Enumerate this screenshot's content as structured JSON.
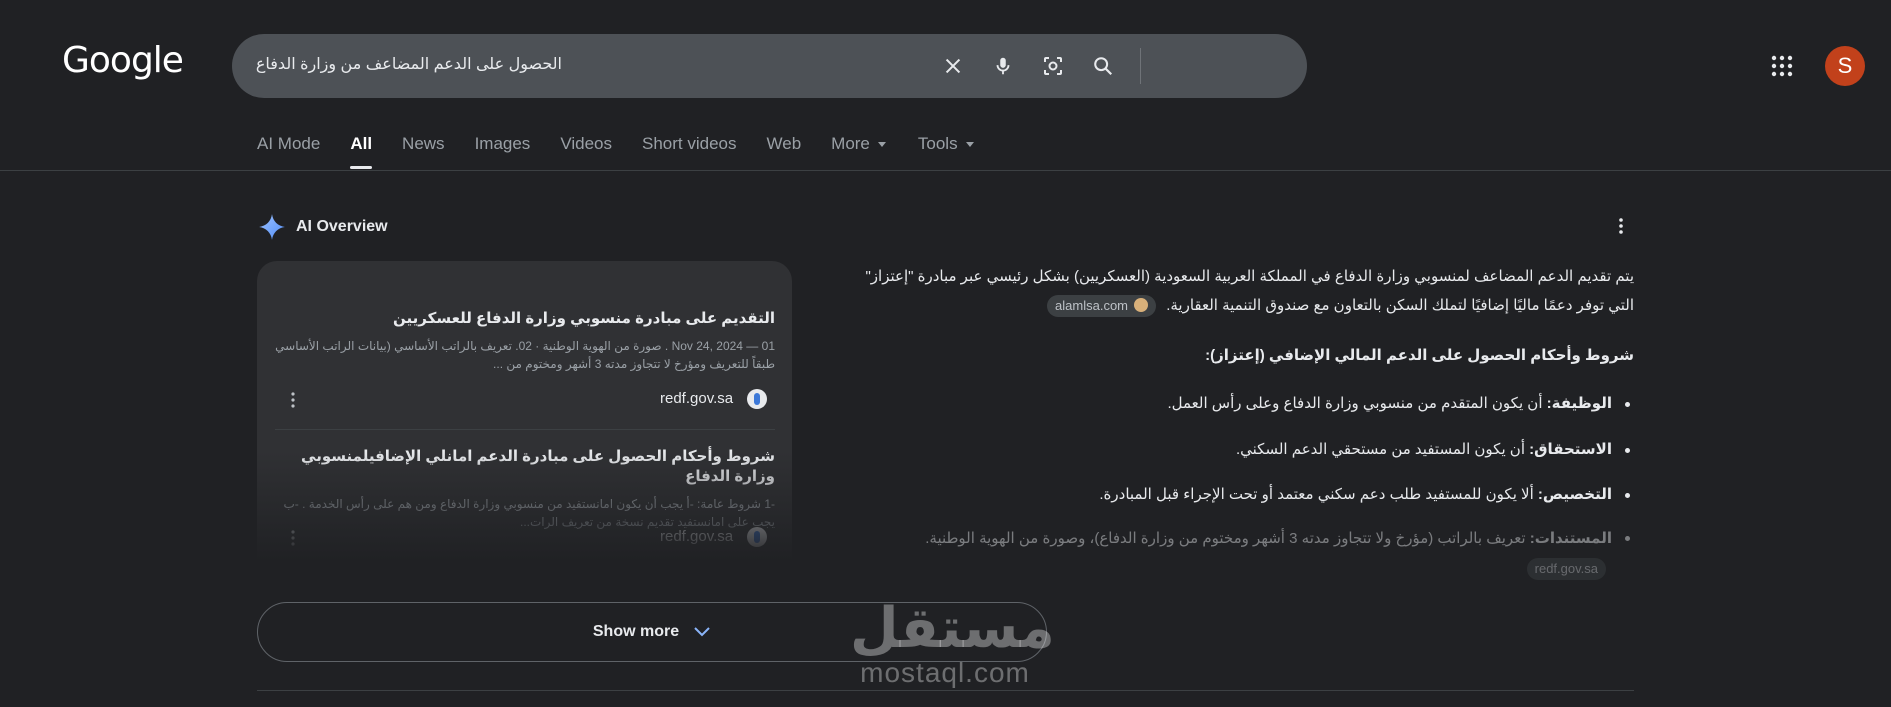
{
  "header": {
    "logo": "Google",
    "search": {
      "query": "الحصول على الدعم المضاعف من وزارة الدفاع"
    },
    "avatar_letter": "S"
  },
  "tabs": [
    {
      "label": "AI Mode"
    },
    {
      "label": "All"
    },
    {
      "label": "News"
    },
    {
      "label": "Images"
    },
    {
      "label": "Videos"
    },
    {
      "label": "Short videos"
    },
    {
      "label": "Web"
    },
    {
      "label": "More"
    },
    {
      "label": "Tools"
    }
  ],
  "ai_overview": {
    "title": "AI Overview",
    "sources": [
      {
        "title": "التقديم على مبادرة منسوبي وزارة الدفاع للعسكريين",
        "snippet": "01 — Nov 24, 2024 . صورة من الهوية الوطنية · 02. تعريف بالراتب الأساسي (بيانات الراتب الأساسي طبقاً للتعريف ومؤرخ لا تتجاوز مدته 3 أشهر ومختوم من ...",
        "site": "redf.gov.sa"
      },
      {
        "title": "شروط وأحكام الحصول على مبادرة الدعم امانلي الإضافيلمنسوبي وزارة الدفاع",
        "snippet": "-1 شروط عامة: -أ يجب أن يكون امانستفيد من منسوبي وزارة الدفاع ومن هم على رأس الخدمة . -ب يجب على امانستفيد تقديم نسخة من تعريف الرات...",
        "site": "redf.gov.sa"
      }
    ],
    "intro": "يتم تقديم الدعم المضاعف لمنسوبي وزارة الدفاع في المملكة العربية السعودية (العسكريين) بشكل رئيسي عبر مبادرة \"إعتزاز\" التي توفر دعمًا ماليًا إضافيًا لتملك السكن بالتعاون مع صندوق التنمية العقارية.",
    "intro_cite": "alamlsa.com",
    "conditions_heading": "شروط وأحكام الحصول على الدعم المالي الإضافي (إعتزاز):",
    "bullets": [
      {
        "term": "الوظيفة:",
        "text": " أن يكون المتقدم من منسوبي وزارة الدفاع وعلى رأس العمل."
      },
      {
        "term": "الاستحقاق:",
        "text": " أن يكون المستفيد من مستحقي الدعم السكني."
      },
      {
        "term": "التخصيص:",
        "text": " ألا يكون للمستفيد طلب دعم سكني معتمد أو تحت الإجراء قبل المبادرة."
      },
      {
        "term": "المستندات:",
        "text": " تعريف بالراتب (مؤرخ ولا تتجاوز مدته 3 أشهر ومختوم من وزارة الدفاع)، وصورة من الهوية الوطنية."
      }
    ],
    "last_cite": "redf.gov.sa",
    "show_more": "Show more"
  },
  "watermark": {
    "arabic": "مستقل",
    "latin": "mostaql.com"
  }
}
